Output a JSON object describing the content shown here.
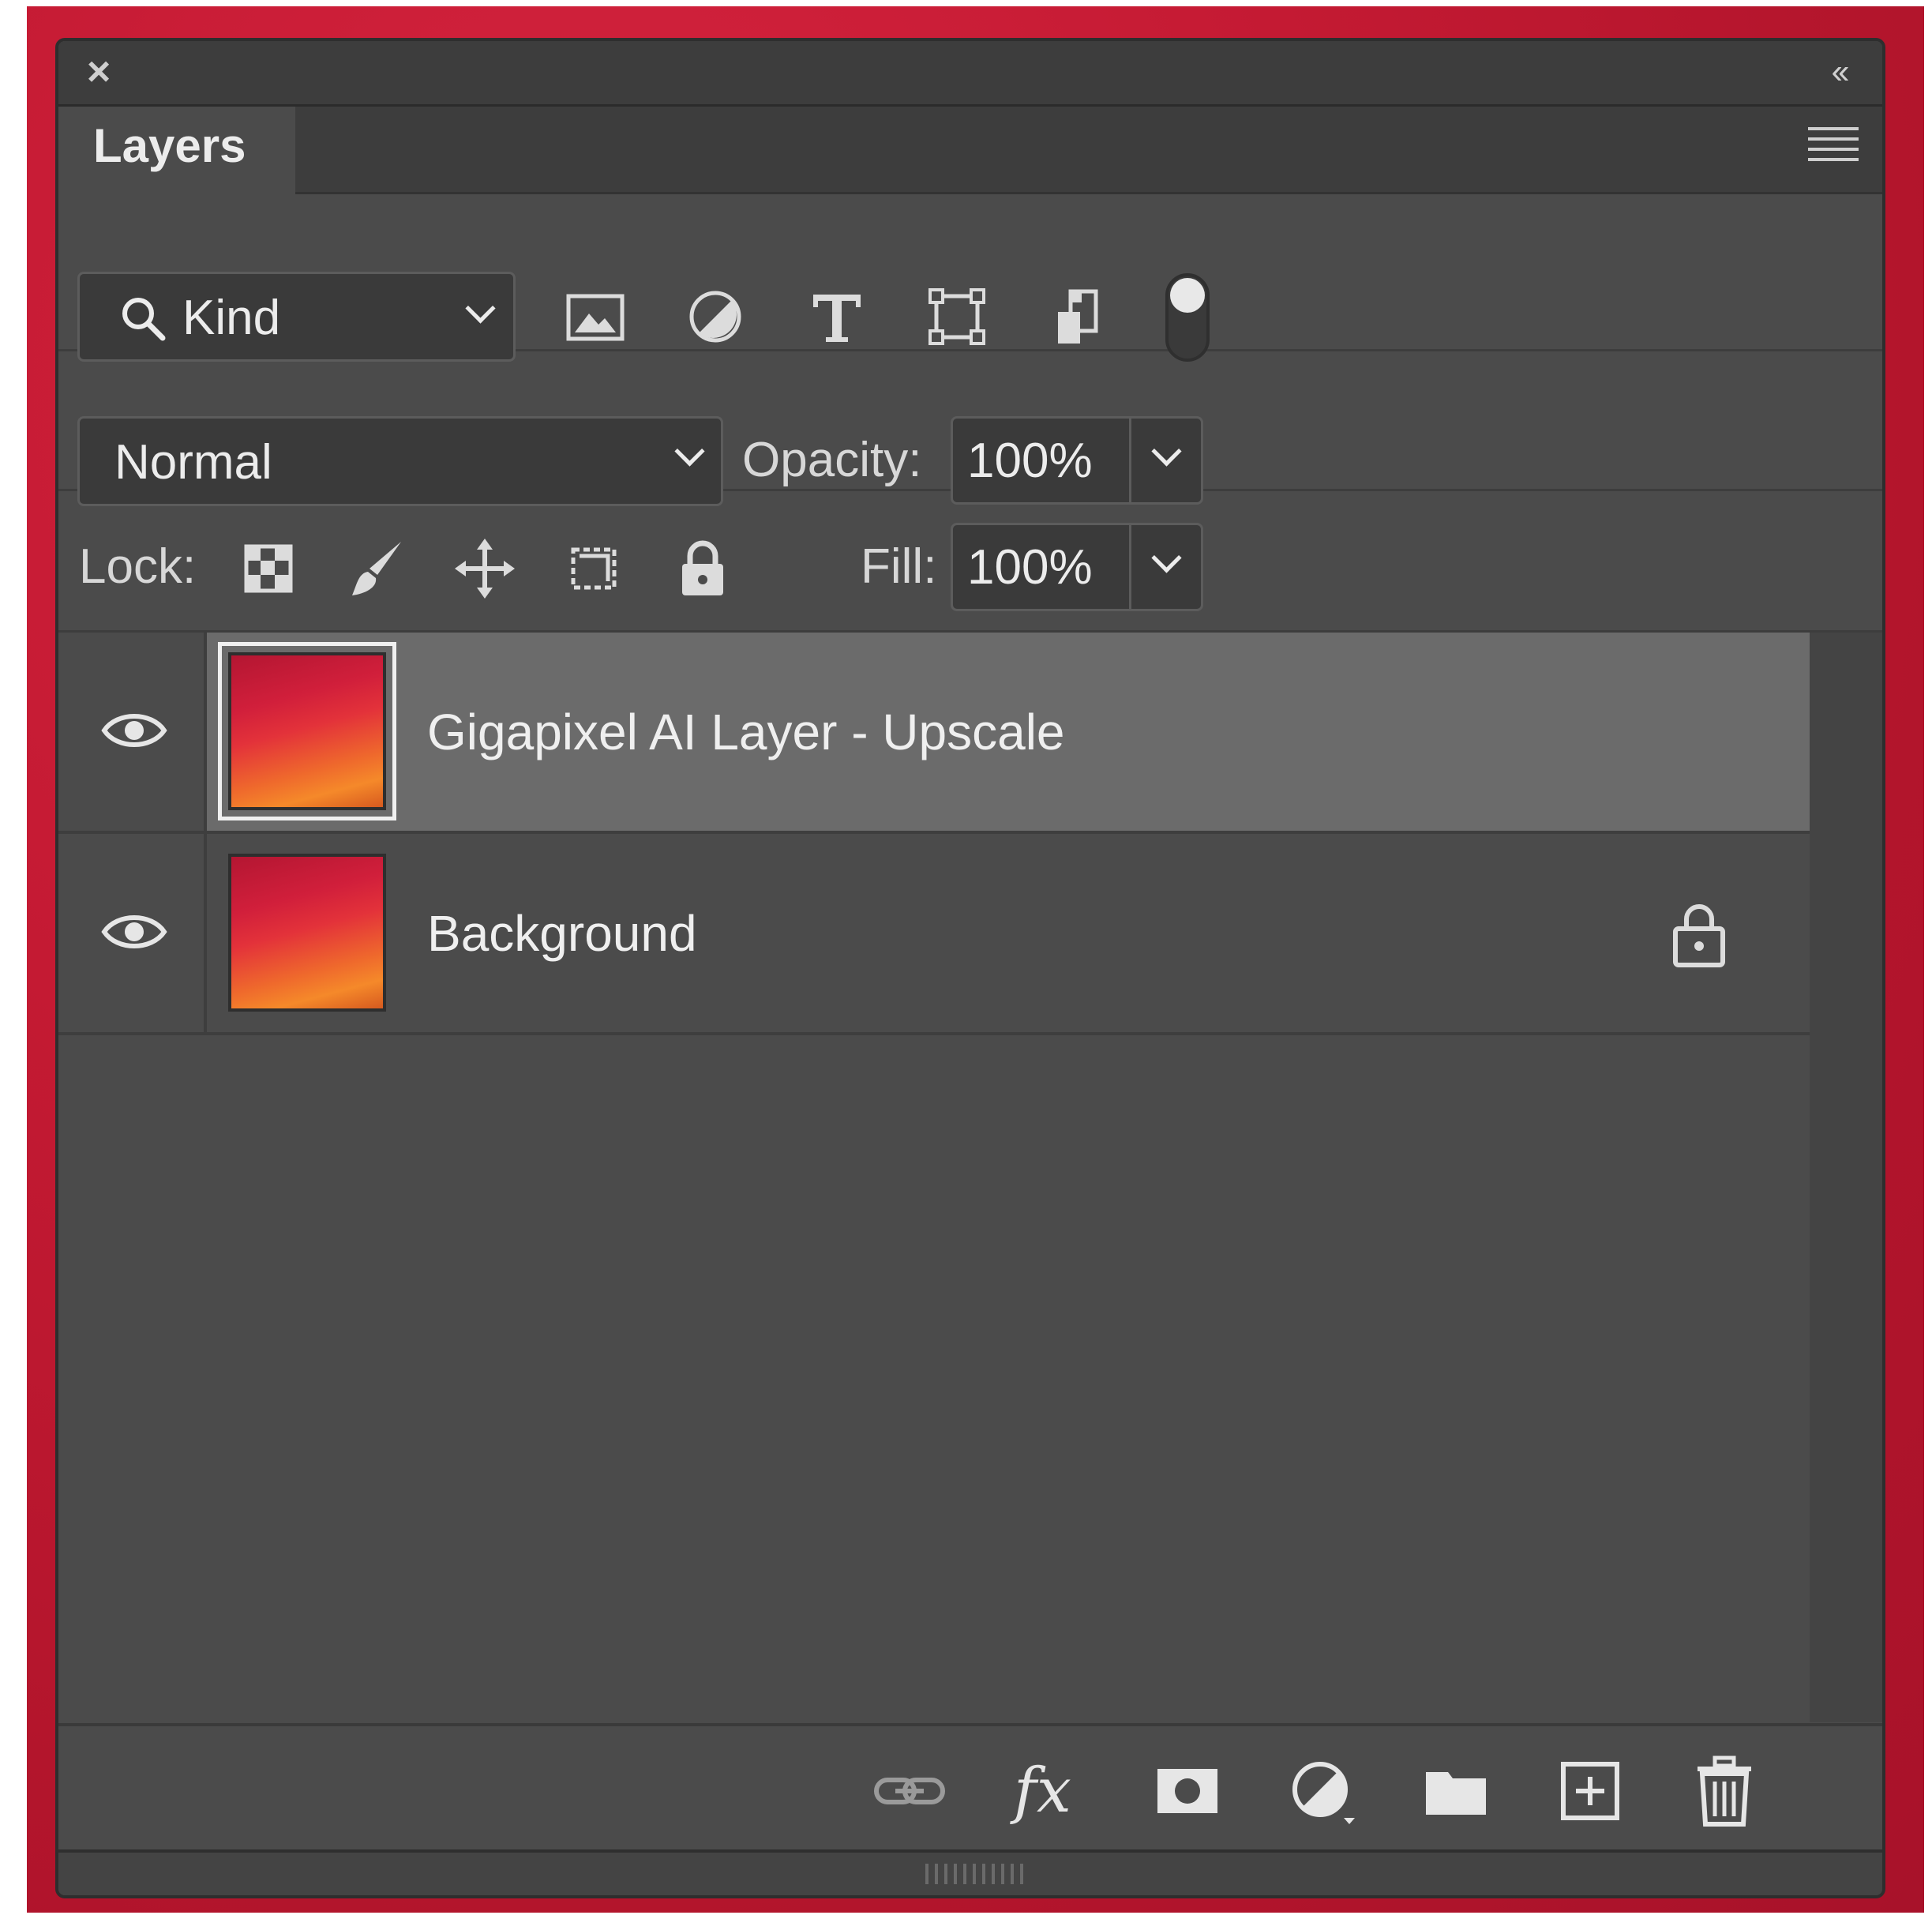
{
  "panel": {
    "close_icon": "×",
    "collapse_icon": "‹‹"
  },
  "tab": {
    "label": "Layers"
  },
  "filter": {
    "kind_label": "Kind",
    "icons": [
      "image-filter-icon",
      "adjustment-filter-icon",
      "type-filter-icon",
      "shape-filter-icon",
      "smart-object-filter-icon",
      "filter-toggle-icon"
    ]
  },
  "blend": {
    "mode": "Normal",
    "opacity_label": "Opacity:",
    "opacity_value": "100%"
  },
  "lock": {
    "label": "Lock:",
    "fill_label": "Fill:",
    "fill_value": "100%"
  },
  "layers": [
    {
      "name": "Gigapixel AI Layer - Upscale",
      "visible": true,
      "selected": true,
      "locked": false
    },
    {
      "name": "Background",
      "visible": true,
      "selected": false,
      "locked": true
    }
  ],
  "footer": {
    "icons": [
      "link-layers-icon",
      "fx-icon",
      "mask-icon",
      "adjustment-layer-icon",
      "group-folder-icon",
      "new-layer-icon",
      "delete-icon"
    ],
    "fx_label": "fx"
  }
}
